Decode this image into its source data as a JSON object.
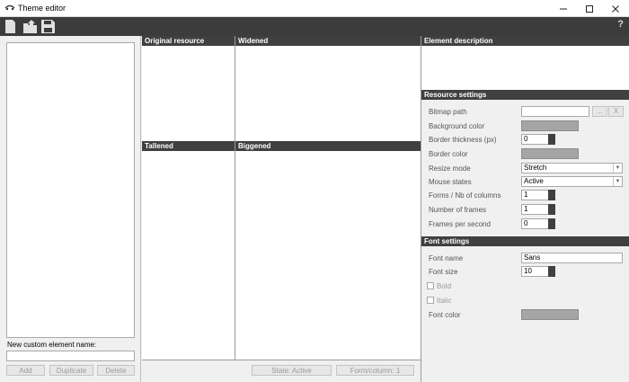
{
  "window": {
    "title": "Theme editor"
  },
  "toolbar": {
    "help": "?"
  },
  "left": {
    "new_name_label": "New custom element name:",
    "new_name_value": "",
    "add": "Add",
    "duplicate": "Duplicate",
    "delete": "Delete"
  },
  "preview": {
    "original": "Original resource",
    "widened": "Widened",
    "tallened": "Tallened",
    "biggened": "Biggened",
    "state_button": "State: Active",
    "form_button": "Form/column: 1"
  },
  "description": {
    "header": "Element description"
  },
  "resource_settings": {
    "header": "Resource settings",
    "bitmap_path_label": "Bitmap path",
    "bitmap_path_value": "",
    "browse": "...",
    "clear": "X",
    "background_color_label": "Background color",
    "background_color": "#a5a5a5",
    "border_thickness_label": "Border thickness (px)",
    "border_thickness_value": "0",
    "border_color_label": "Border color",
    "border_color": "#a5a5a5",
    "resize_mode_label": "Resize mode",
    "resize_mode_value": "Stretch",
    "mouse_states_label": "Mouse states",
    "mouse_states_value": "Active",
    "forms_label": "Forms / Nb of columns",
    "forms_value": "1",
    "frames_label": "Number of frames",
    "frames_value": "1",
    "fps_label": "Frames per second",
    "fps_value": "0"
  },
  "font_settings": {
    "header": "Font settings",
    "font_name_label": "Font name",
    "font_name_value": "Sans",
    "font_size_label": "Font size",
    "font_size_value": "10",
    "bold_label": "Bold",
    "italic_label": "Italic",
    "font_color_label": "Font color",
    "font_color": "#a5a5a5"
  }
}
